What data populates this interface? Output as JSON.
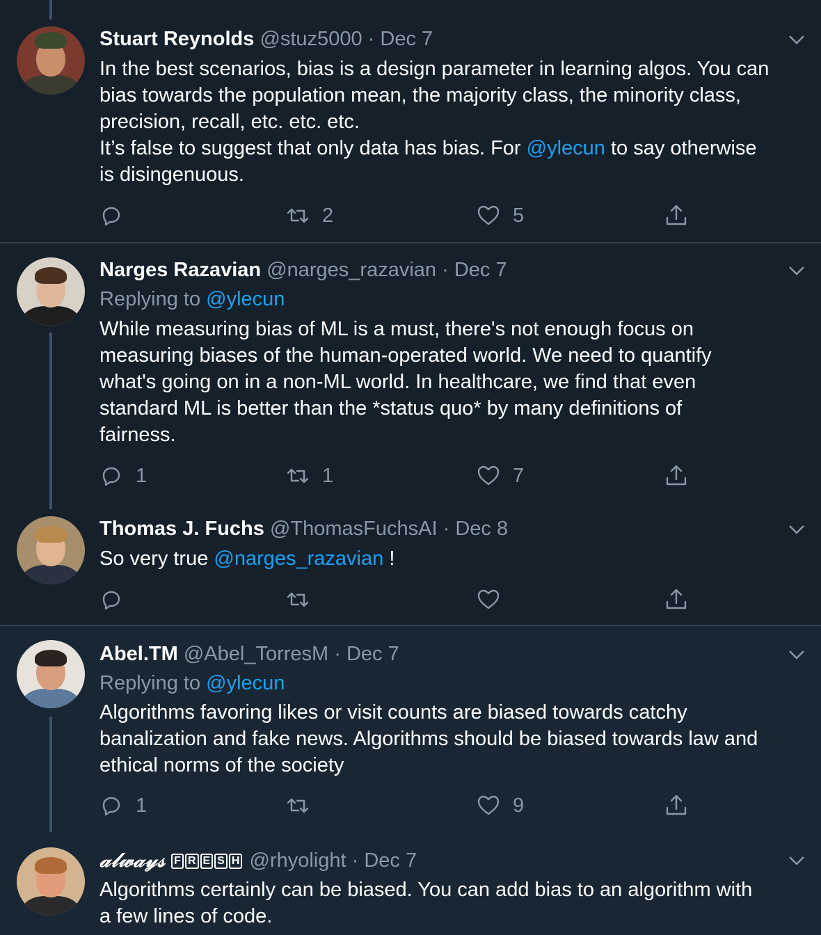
{
  "tweets": [
    {
      "name": "Stuart Reynolds",
      "handle": "@stuz5000",
      "dot": "·",
      "date": "Dec 7",
      "replying_prefix": "",
      "replying_mention": "",
      "text_lines": [
        "In the best scenarios, bias is a design parameter in learning algos. You can",
        "bias towards the population mean, the majority class, the minority class,",
        "precision, recall, etc. etc. etc."
      ],
      "text_line4_pre": "It’s false to suggest that only data has bias. For ",
      "text_line4_mention": "@ylecun",
      "text_line4_post": " to say otherwise",
      "text_line5": "is disingenuous.",
      "reply_count": "",
      "retweet_count": "2",
      "like_count": "5"
    },
    {
      "name": "Narges Razavian",
      "handle": "@narges_razavian",
      "dot": "·",
      "date": "Dec 7",
      "replying_prefix": "Replying to ",
      "replying_mention": "@ylecun",
      "text_lines": [
        "While measuring bias of ML is a must, there's not enough focus on",
        "measuring biases of the human-operated world. We need to quantify",
        "what's going on in a non-ML world. In healthcare, we find that even",
        "standard ML is better than the *status quo* by many definitions of",
        "fairness."
      ],
      "reply_count": "1",
      "retweet_count": "1",
      "like_count": "7"
    },
    {
      "name": "Thomas J. Fuchs",
      "handle": "@ThomasFuchsAI",
      "dot": "·",
      "date": "Dec 8",
      "text_pre": "So very true ",
      "text_mention": "@narges_razavian",
      "text_post": " !",
      "reply_count": "",
      "retweet_count": "",
      "like_count": ""
    },
    {
      "name": "Abel.TM",
      "handle": "@Abel_TorresM",
      "dot": "·",
      "date": "Dec 7",
      "replying_prefix": "Replying to ",
      "replying_mention": "@ylecun",
      "text_lines": [
        "Algorithms favoring likes or visit counts are biased towards catchy",
        "banalization and fake news. Algorithms should be biased towards law and",
        "ethical norms of the society"
      ],
      "reply_count": "1",
      "retweet_count": "",
      "like_count": "9"
    },
    {
      "name_fancy": "𝒶𝓁𝓌𝒶𝓎𝓈",
      "name_boxed": [
        "F",
        "R",
        "E",
        "S",
        "H"
      ],
      "handle": "@rhyolight",
      "dot": "·",
      "date": "Dec 7",
      "text_lines": [
        "Algorithms certainly can be biased. You can add bias to an algorithm with",
        "a few lines of code."
      ]
    }
  ],
  "icons": {
    "reply": "reply-icon",
    "retweet": "retweet-icon",
    "like": "heart-icon",
    "share": "share-icon",
    "more": "chevron-down-icon"
  },
  "colors": {
    "background": "#15202b",
    "highlight_background": "#192734",
    "accent": "#1da1f2",
    "muted": "#8899a6",
    "separator": "#38444d",
    "thread_line": "#3d5466"
  }
}
